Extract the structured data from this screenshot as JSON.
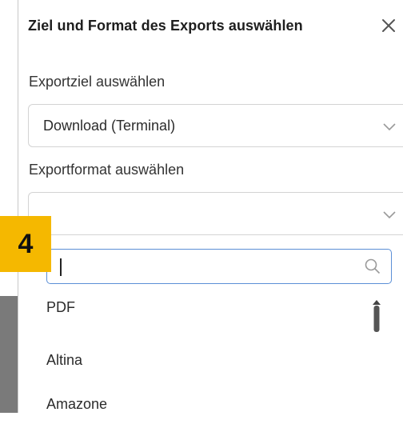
{
  "dialog": {
    "title": "Ziel und Format des Exports auswählen",
    "close_icon": "close-icon"
  },
  "destination": {
    "label": "Exportziel auswählen",
    "selected": "Download (Terminal)"
  },
  "format": {
    "label": "Exportformat auswählen",
    "selected": "",
    "search_placeholder": "",
    "options": [
      "PDF",
      "Altina",
      "Amazone"
    ]
  },
  "step_badge": "4",
  "colors": {
    "badge": "#f5b800",
    "focus_border": "#5b8fd6"
  }
}
